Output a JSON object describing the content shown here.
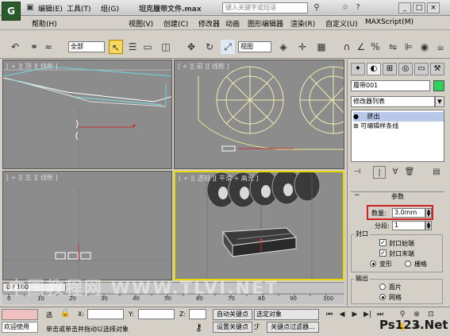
{
  "app": {
    "logo_text": "G",
    "title": "坦克履带文件.max",
    "search_placeholder": "键入关键字或短语"
  },
  "menu": {
    "row1": [
      "编辑(E)",
      "工具(T)",
      "组(G)",
      "视图(V)",
      "创建(C)",
      "修改器",
      "动画",
      "图形编辑器",
      "渲染(R)",
      "自定义(U)",
      "MAXScript(M)"
    ],
    "row2": [
      "帮助(H)"
    ]
  },
  "toolbar": {
    "selection_filter": "全部",
    "ref_coord": "视图"
  },
  "viewports": {
    "top": {
      "label": "[ + ][ 顶 ][ 线框 ]"
    },
    "front": {
      "label": "[ + ][ 前 ][ 线框 ]"
    },
    "left": {
      "label": "[ + ][ 左 ][ 线框 ]"
    },
    "perspective": {
      "label": "[ + ][ 透视 ][ 平滑 + 高光 ]"
    }
  },
  "command_panel": {
    "object_name": "履带001",
    "modifier_list": "修改器列表",
    "stack": [
      "挤出",
      "可编辑样条线"
    ],
    "params_title": "参数",
    "amount_label": "数量:",
    "amount_value": "3.0mm",
    "segments_label": "分段:",
    "segments_value": "1",
    "capping": {
      "title": "封口",
      "cap_start": "封口始端",
      "cap_end": "封口末端",
      "morph": "变形",
      "grid": "栅格"
    },
    "output": {
      "title": "输出",
      "patch": "面片",
      "mesh": "网格"
    }
  },
  "timeline": {
    "frame": "0 / 100",
    "ticks": [
      "0",
      "10",
      "20",
      "30",
      "40",
      "50",
      "60",
      "70",
      "80",
      "90",
      "100"
    ]
  },
  "statusbar": {
    "welcome": "欢迎使用",
    "selected": "选",
    "prompt": "单击或单击并拖动以选择对象",
    "x_label": "X:",
    "y_label": "Y:",
    "z_label": "Z:",
    "auto_key": "自动关键点",
    "set_key": "设置关键点",
    "selected_object": "选定对象",
    "key_filters": "关键点过滤器..."
  },
  "watermark": "中国教程网 WWW.TLVI.NET",
  "ps_logo": "Ps123.Net",
  "colors": {
    "active_viewport": "#e8d800",
    "object_color": "#2dd05a",
    "highlight": "#d02020"
  }
}
